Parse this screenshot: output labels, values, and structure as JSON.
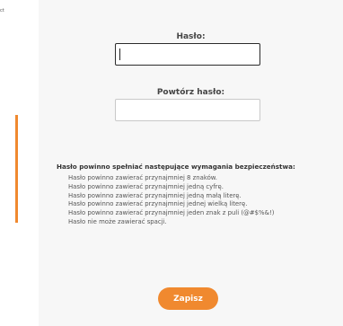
{
  "side": {
    "text": "ct"
  },
  "form": {
    "password_label": "Hasło:",
    "password_value": "",
    "repeat_label": "Powtórz hasło:",
    "repeat_value": ""
  },
  "requirements": {
    "title": "Hasło powinno spełniać następujące wymagania bezpieczeństwa:",
    "items": [
      "Hasło powinno zawierać przynajmniej 8 znaków.",
      "Hasło powinno zawierać przynajmniej jedną cyfrę.",
      "Hasło powinno zawierać przynajmniej jedną małą literę.",
      "Hasło powinno zawierać przynajmniej jednej wielką literę.",
      "Hasło powinno zawierać przynajmniej jeden znak z puli (@#$%&!)",
      "Hasło nie może zawierać spacji."
    ]
  },
  "actions": {
    "save_label": "Zapisz"
  },
  "colors": {
    "accent": "#f0892f",
    "panel": "#f7f7f7"
  }
}
